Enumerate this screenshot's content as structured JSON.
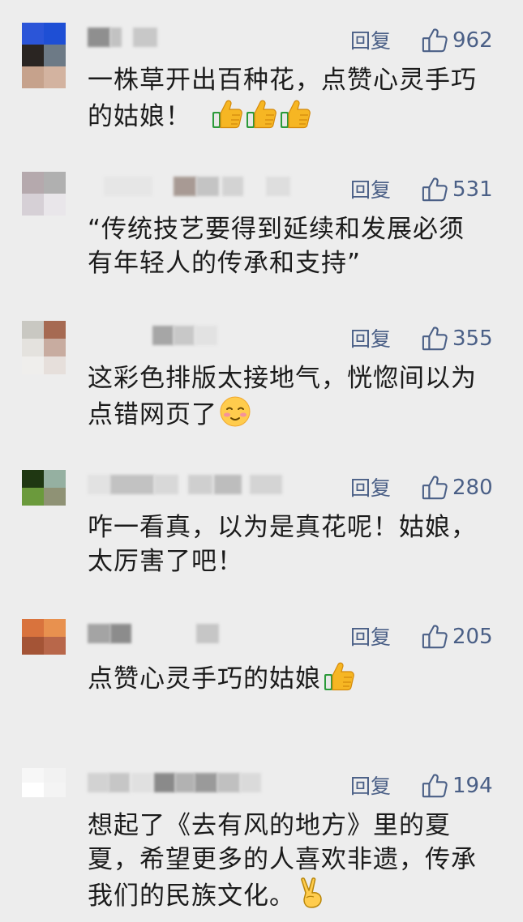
{
  "reply_label": "回复",
  "icons": {
    "like": "thumbs-up-outline-icon",
    "thumbs_emoji": "thumbs-up-emoji-icon",
    "blush_emoji": "blushing-face-emoji-icon",
    "victory_emoji": "victory-hand-emoji-icon"
  },
  "colors": {
    "background": "#ededed",
    "link": "#4a5f86",
    "text": "#1b1b1b"
  },
  "comments": [
    {
      "likes": "962",
      "lines": [
        "一株草开出百种花，点赞心灵手巧",
        "的姑娘！"
      ]
    },
    {
      "likes": "531",
      "lines": [
        "“传统技艺要得到延续和发展必须",
        "有年轻人的传承和支持”"
      ]
    },
    {
      "likes": "355",
      "lines": [
        "这彩色排版太接地气，恍惚间以为",
        "点错网页了"
      ]
    },
    {
      "likes": "280",
      "lines": [
        "咋一看真，以为是真花呢！姑娘，",
        "太厉害了吧！"
      ]
    },
    {
      "likes": "205",
      "lines": [
        "点赞心灵手巧的姑娘"
      ]
    },
    {
      "likes": "194",
      "lines": [
        "想起了《去有风的地方》里的夏",
        "夏，希望更多的人喜欢非遗，传承",
        "我们的民族文化。"
      ]
    }
  ]
}
